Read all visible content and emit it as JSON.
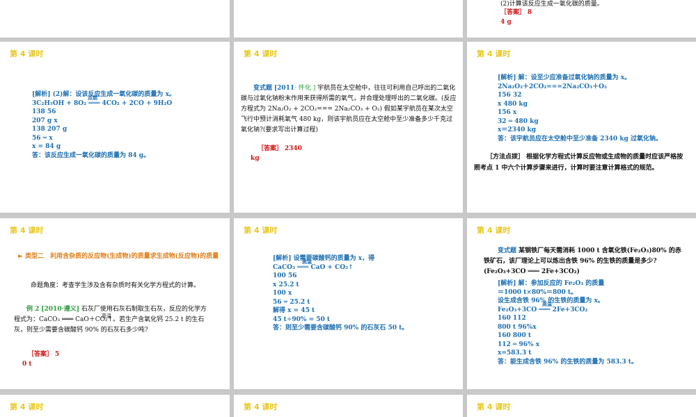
{
  "header_label": "第 4 课时",
  "top": {
    "right": {
      "line1": "(2)计算该反应生成一氧化碳的质量。",
      "answer_tag": "［答案］",
      "answer_a": "8",
      "answer_b": "4 g"
    }
  },
  "s1": {
    "lines": [
      "[解析] (2)解：设该反应生成一氧化碳的质量为 x。",
      "3C₂H₅OH + 8O₂ ═══ 4CO₂ + 2CO + 9H₂O",
      "138    56",
      "207 g     x",
      "138  207 g",
      " 56 ═  x",
      "x = 84 g",
      "答：该反应生成一氧化碳的质量为 84 g。"
    ],
    "condition": "点燃"
  },
  "s2": {
    "label": "变式题",
    "source": "[2011",
    "source_city": "· 怀化 ]",
    "text": "宇航员在太空舱中，往往可利用自己呼出的二氧化碳与过氧化钠粉末作用来获得所需的氧气，并合理处理呼出的二氧化碳。(反应方程式为 2Na₂O₂ + 2CO₂=== 2Na₂CO₃ + O₂) 假如某宇航员在某次太空飞行中预计消耗氧气 480 kg，则该宇航员应在太空舱中至少准备多少千克过氧化钠?(要求写出计算过程)",
    "answer_tag": "［答案］",
    "answer_a": "2340",
    "answer_b": "kg"
  },
  "s3": {
    "lines": [
      "[解析] 解：设至少应准备过氧化钠的质量为 x。",
      "2Na₂O₂＋2CO₂===2Na₂CO₃＋O₂",
      "156     32",
      "x     480 kg",
      "156      x",
      " 32 ═ 480 kg",
      "x＝2340 kg",
      "答：该宇航员应在太空舱中至少准备 2340 kg 过氧化钠。"
    ],
    "method_tag": "［方法点拨］",
    "method_text": "根据化学方程式计算反应物或生成物的质量时应该严格按照考点 1 中六个计算步骤来进行，计算时要注意计算格式的规范。"
  },
  "s4": {
    "bullet": "►",
    "title": "类型二　利用含杂质的反应物(生成物)的质量求生成物(反应物)的质量",
    "intro": "命题角度：考查学生涉及含有杂质时有关化学方程式的计算。",
    "ex_label": "例 2",
    "ex_source": "[2010·遵义]",
    "ex_text": "石灰厂使用石灰石制取生石灰，反应的化学方程式为：CaCO₃ ═══ CaO＋CO₂↑。若生产含氧化钙 25.2 t 的生石灰，则至少需要含碳酸钙 90% 的石灰石多少吨?",
    "condition": "高温",
    "answer_tag": "［答案］",
    "answer_a": "5",
    "answer_b": "0 t"
  },
  "s5": {
    "lines": [
      "[解析] 设需要碳酸钙的质量为 x，得",
      "CaCO₃ ═══ CaO + CO₂↑",
      "100    56",
      "x     25.2 t",
      "100      x",
      " 56 ═ 25.2 t",
      "解得 x = 45 t",
      "45 t÷90% = 50 t",
      "答：则至少需要含碳酸钙 90% 的石灰石 50 t。"
    ],
    "condition": "高温"
  },
  "s6": {
    "label": "变式题",
    "text": "某钢铁厂每天需消耗 1000 t 含氧化铁(Fe₂O₃)80% 的赤铁矿石，该厂理论上可以炼出含铁 96% 的生铁的质量是多少?(Fe₂O₃+3CO ═══ 2Fe+3CO₂)",
    "condition": "高温",
    "lines": [
      "[解析] 解：参加反应的 Fe₂O₃ 的质量",
      "＝1000 t×80%＝800 t。",
      "设生成含铁 96% 的生铁的质量为 x。",
      "Fe₂O₃+3CO ═══ 2Fe+3CO₂",
      "160       112",
      "800 t    96%x",
      "160     800 t",
      "112 ═ 96% x",
      "x=583.3 t",
      "答：能生成含铁 96% 的生铁的质量为 583.3 t。"
    ]
  },
  "colors": {
    "header": "#e8c81c",
    "blue": "#1d6fb0",
    "red": "#d01818",
    "orange": "#e07f1a",
    "green": "#2e9e3e",
    "gap": "#c8c8c8"
  }
}
